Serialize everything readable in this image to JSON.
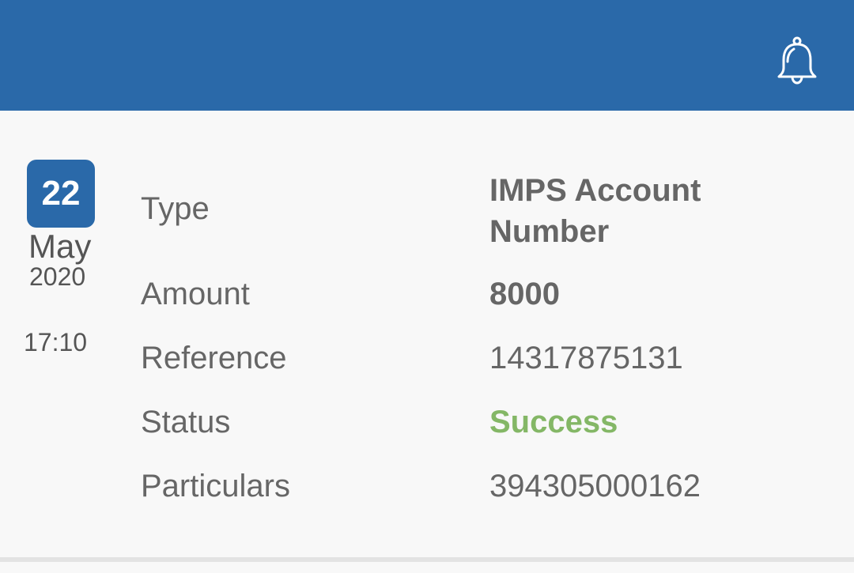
{
  "header": {
    "background": "#2a69a9",
    "notification_icon": "bell-icon"
  },
  "transaction": {
    "date": {
      "day": "22",
      "month": "May",
      "year": "2020",
      "time": "17:10"
    },
    "fields": {
      "type_label": "Type",
      "type_value": "IMPS Account Number",
      "amount_label": "Amount",
      "amount_value": "8000",
      "reference_label": "Reference",
      "reference_value": "14317875131",
      "status_label": "Status",
      "status_value": "Success",
      "particulars_label": "Particulars",
      "particulars_value": "394305000162"
    },
    "status_color": "#84b766"
  }
}
